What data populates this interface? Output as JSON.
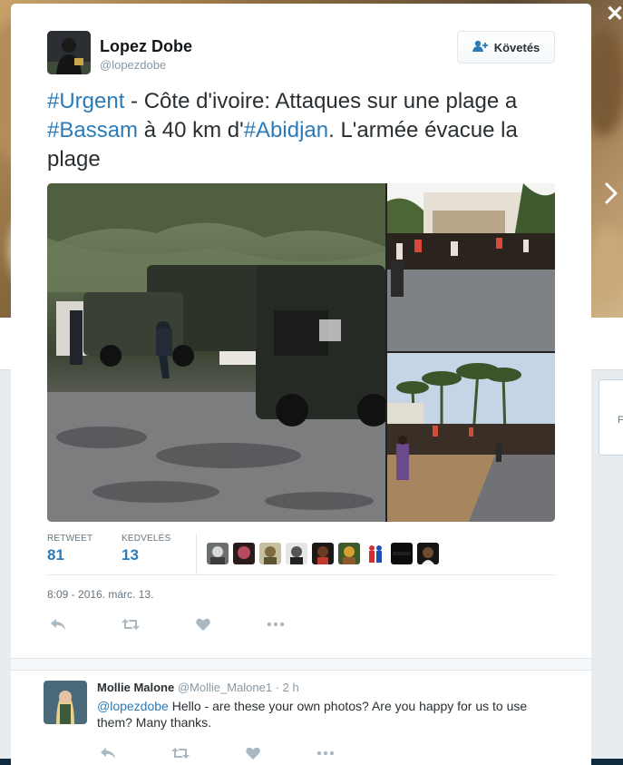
{
  "window": {
    "close_label": "✕"
  },
  "tweet": {
    "author": {
      "name": "Lopez Dobe",
      "handle": "@lopezdobe"
    },
    "follow_label": "Követés",
    "text": {
      "t1": "#Urgent",
      "t2": " - Côte d'ivoire: Attaques sur une plage a ",
      "t3": "#Bassam",
      "t4": " à 40 km d'",
      "t5": "#Abidjan",
      "t6": ". L'armée évacue la plage"
    },
    "stats": {
      "retweet_label": "RETWEET",
      "retweet_count": "81",
      "like_label": "KEDVELÉS",
      "like_count": "13"
    },
    "timestamp": "8:09 - 2016. márc. 13.",
    "likers": [
      "avatar-1",
      "avatar-2",
      "avatar-3",
      "avatar-4",
      "avatar-5",
      "avatar-6",
      "avatar-7",
      "avatar-8",
      "avatar-9"
    ]
  },
  "reply": {
    "name": "Mollie Malone",
    "handle": "@Mollie_Malone1",
    "time": " · 2 h",
    "mention": "@lopezdobe",
    "text": " Hello - are these your own photos? Are you happy for us to use them? Many thanks."
  },
  "background": {
    "card_letter": "F"
  },
  "colors": {
    "link": "#2b7bb9",
    "text": "#292f33",
    "muted": "#8899a6"
  },
  "icons": [
    "reply-icon",
    "retweet-icon",
    "like-icon",
    "more-icon",
    "follow-user-icon",
    "close-icon",
    "next-arrow-icon"
  ]
}
